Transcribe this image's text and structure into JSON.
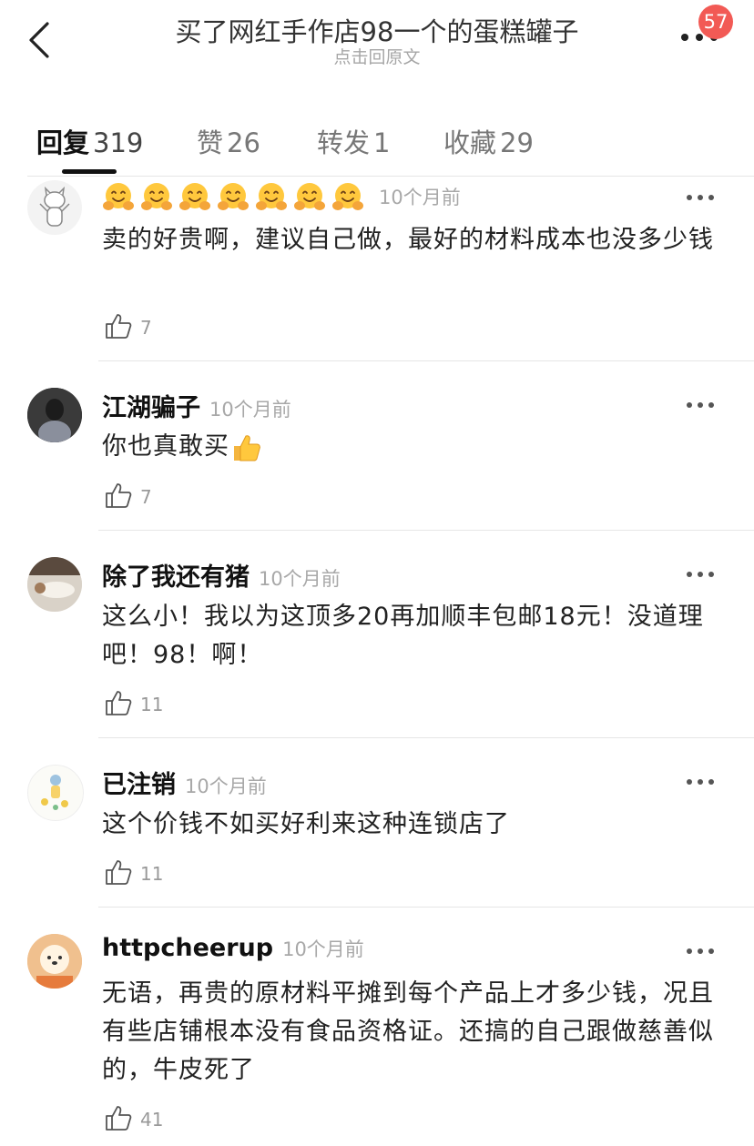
{
  "header": {
    "title": "买了网红手作店98一个的蛋糕罐子",
    "subtitle": "点击回原文",
    "badge": "57"
  },
  "tabs": [
    {
      "label": "回复",
      "count": "319"
    },
    {
      "label": "赞",
      "count": "26"
    },
    {
      "label": "转发",
      "count": "1"
    },
    {
      "label": "收藏",
      "count": "29"
    }
  ],
  "comments": [
    {
      "name": "",
      "time": "10个月前",
      "text": "卖的好贵啊，建议自己做，最好的材料成本也没多少钱",
      "likes": "7",
      "name_emoji": "hugging-face-emoji",
      "name_emoji_count": 7
    },
    {
      "name": "江湖骗子",
      "time": "10个月前",
      "text": "你也真敢买",
      "likes": "7",
      "text_emoji": "thumbs-up-emoji"
    },
    {
      "name": "除了我还有猪",
      "time": "10个月前",
      "text": "这么小！我以为这顶多20再加顺丰包邮18元！没道理吧！98！啊！",
      "likes": "11"
    },
    {
      "name": "已注销",
      "time": "10个月前",
      "text": "这个价钱不如买好利来这种连锁店了",
      "likes": "11"
    },
    {
      "name": "httpcheerup",
      "time": "10个月前",
      "text": "无语，再贵的原材料平摊到每个产品上才多少钱，况且有些店铺根本没有食品资格证。还搞的自己跟做慈善似的，牛皮死了",
      "likes": "41"
    }
  ],
  "colors": {
    "badge": "#f25a55",
    "muted": "#a8a8a8",
    "text": "#222222"
  }
}
